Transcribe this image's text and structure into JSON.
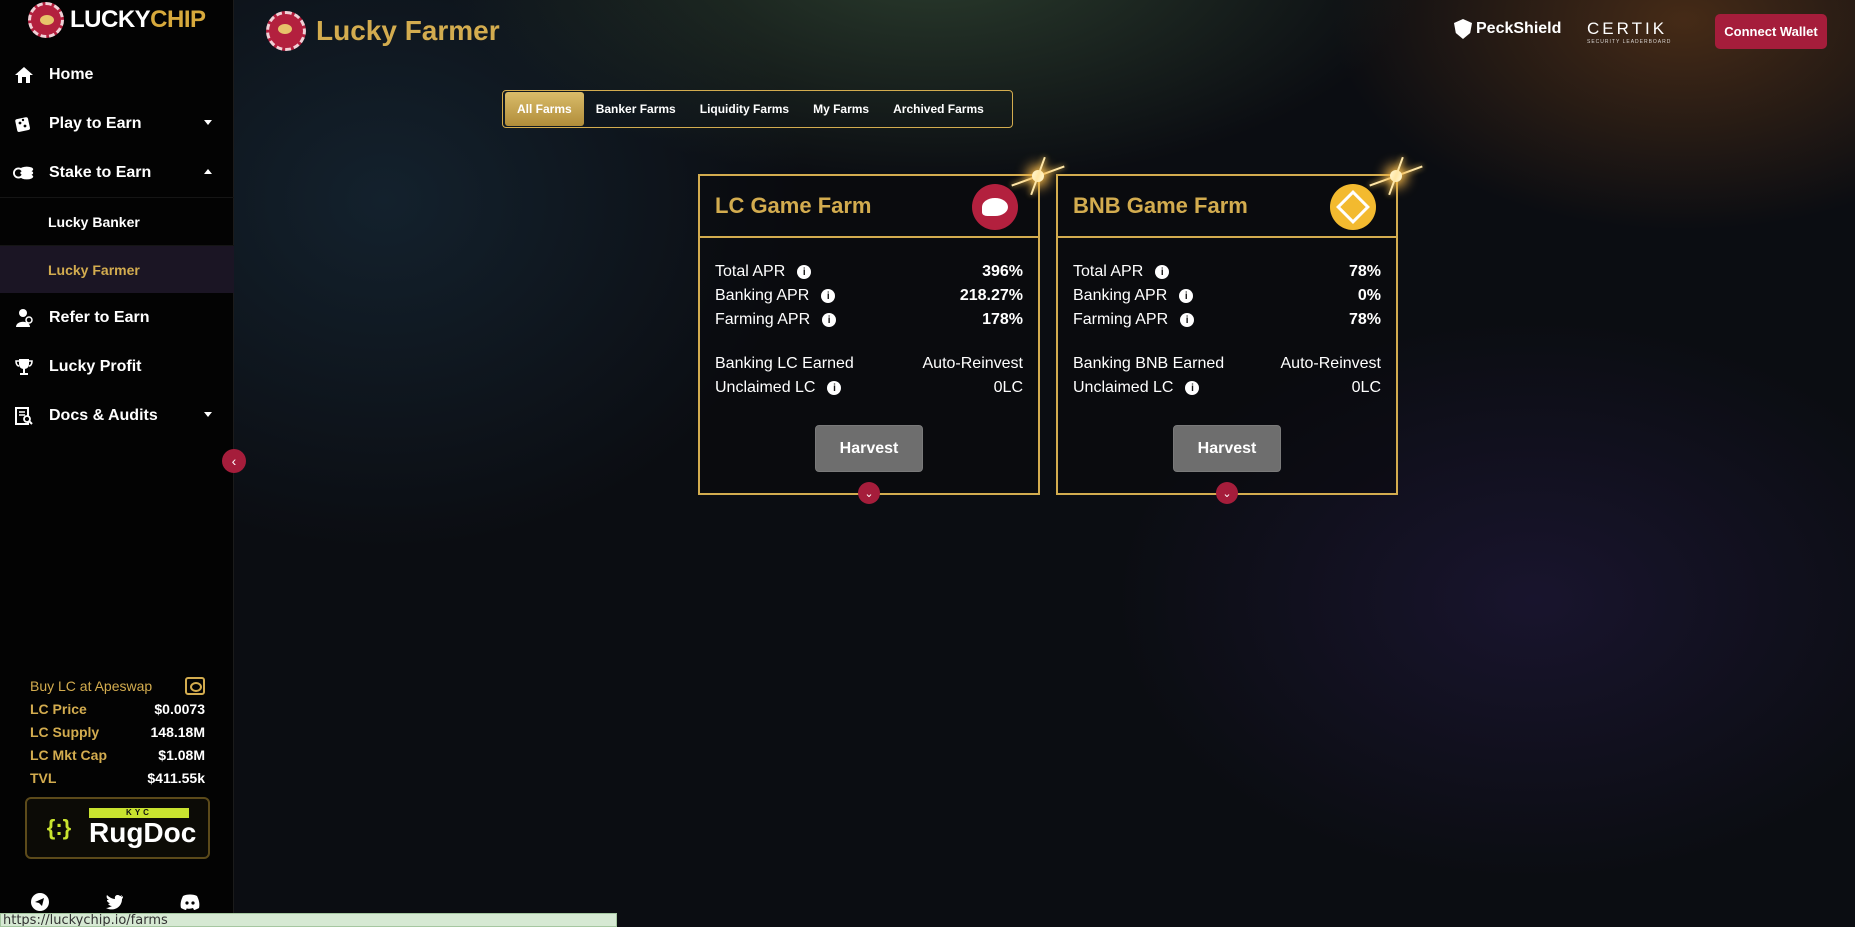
{
  "brand": {
    "name_part1": "LUCKY",
    "name_part2": "CHIP"
  },
  "sidebar": {
    "items": [
      {
        "label": "Home",
        "icon": "home-icon"
      },
      {
        "label": "Play to Earn",
        "icon": "dice-icon"
      },
      {
        "label": "Stake to Earn",
        "icon": "coins-icon"
      }
    ],
    "sub_items": [
      {
        "label": "Lucky Banker"
      },
      {
        "label": "Lucky Farmer"
      }
    ],
    "items_after": [
      {
        "label": "Refer to Earn",
        "icon": "user-add-icon"
      },
      {
        "label": "Lucky Profit",
        "icon": "trophy-icon"
      },
      {
        "label": "Docs & Audits",
        "icon": "document-search-icon"
      }
    ],
    "collapse_glyph": "‹"
  },
  "stats": {
    "buy_label": "Buy LC at Apeswap",
    "rows": [
      {
        "label": "LC Price",
        "value": "$0.0073"
      },
      {
        "label": "LC Supply",
        "value": "148.18M"
      },
      {
        "label": "LC Mkt Cap",
        "value": "$1.08M"
      },
      {
        "label": "TVL",
        "value": "$411.55k"
      }
    ]
  },
  "rugdoc": {
    "kyc": "KYC",
    "name": "RugDoc"
  },
  "status_url": "https://luckychip.io/farms",
  "header": {
    "title": "Lucky Farmer",
    "peckshield": "PeckShield",
    "certik": "CERTIK",
    "certik_sub": "SECURITY LEADERBOARD",
    "connect": "Connect Wallet"
  },
  "tabs": [
    "All Farms",
    "Banker Farms",
    "Liquidity Farms",
    "My Farms",
    "Archived Farms"
  ],
  "farms": [
    {
      "title": "LC Game Farm",
      "token_icon": "lc-token-icon",
      "total_apr_label": "Total APR",
      "total_apr": "396%",
      "banking_apr_label": "Banking APR",
      "banking_apr": "218.27%",
      "farming_apr_label": "Farming APR",
      "farming_apr": "178%",
      "earned_label": "Banking LC Earned",
      "earned": "Auto-Reinvest",
      "unclaimed_label": "Unclaimed LC",
      "unclaimed": "0LC",
      "harvest": "Harvest"
    },
    {
      "title": "BNB Game Farm",
      "token_icon": "bnb-token-icon",
      "total_apr_label": "Total APR",
      "total_apr": "78%",
      "banking_apr_label": "Banking APR",
      "banking_apr": "0%",
      "farming_apr_label": "Farming APR",
      "farming_apr": "78%",
      "earned_label": "Banking BNB Earned",
      "earned": "Auto-Reinvest",
      "unclaimed_label": "Unclaimed LC",
      "unclaimed": "0LC",
      "harvest": "Harvest"
    }
  ],
  "colors": {
    "gold": "#d3ac4f",
    "crimson": "#a51d3b",
    "bnb": "#f3ba2f"
  }
}
